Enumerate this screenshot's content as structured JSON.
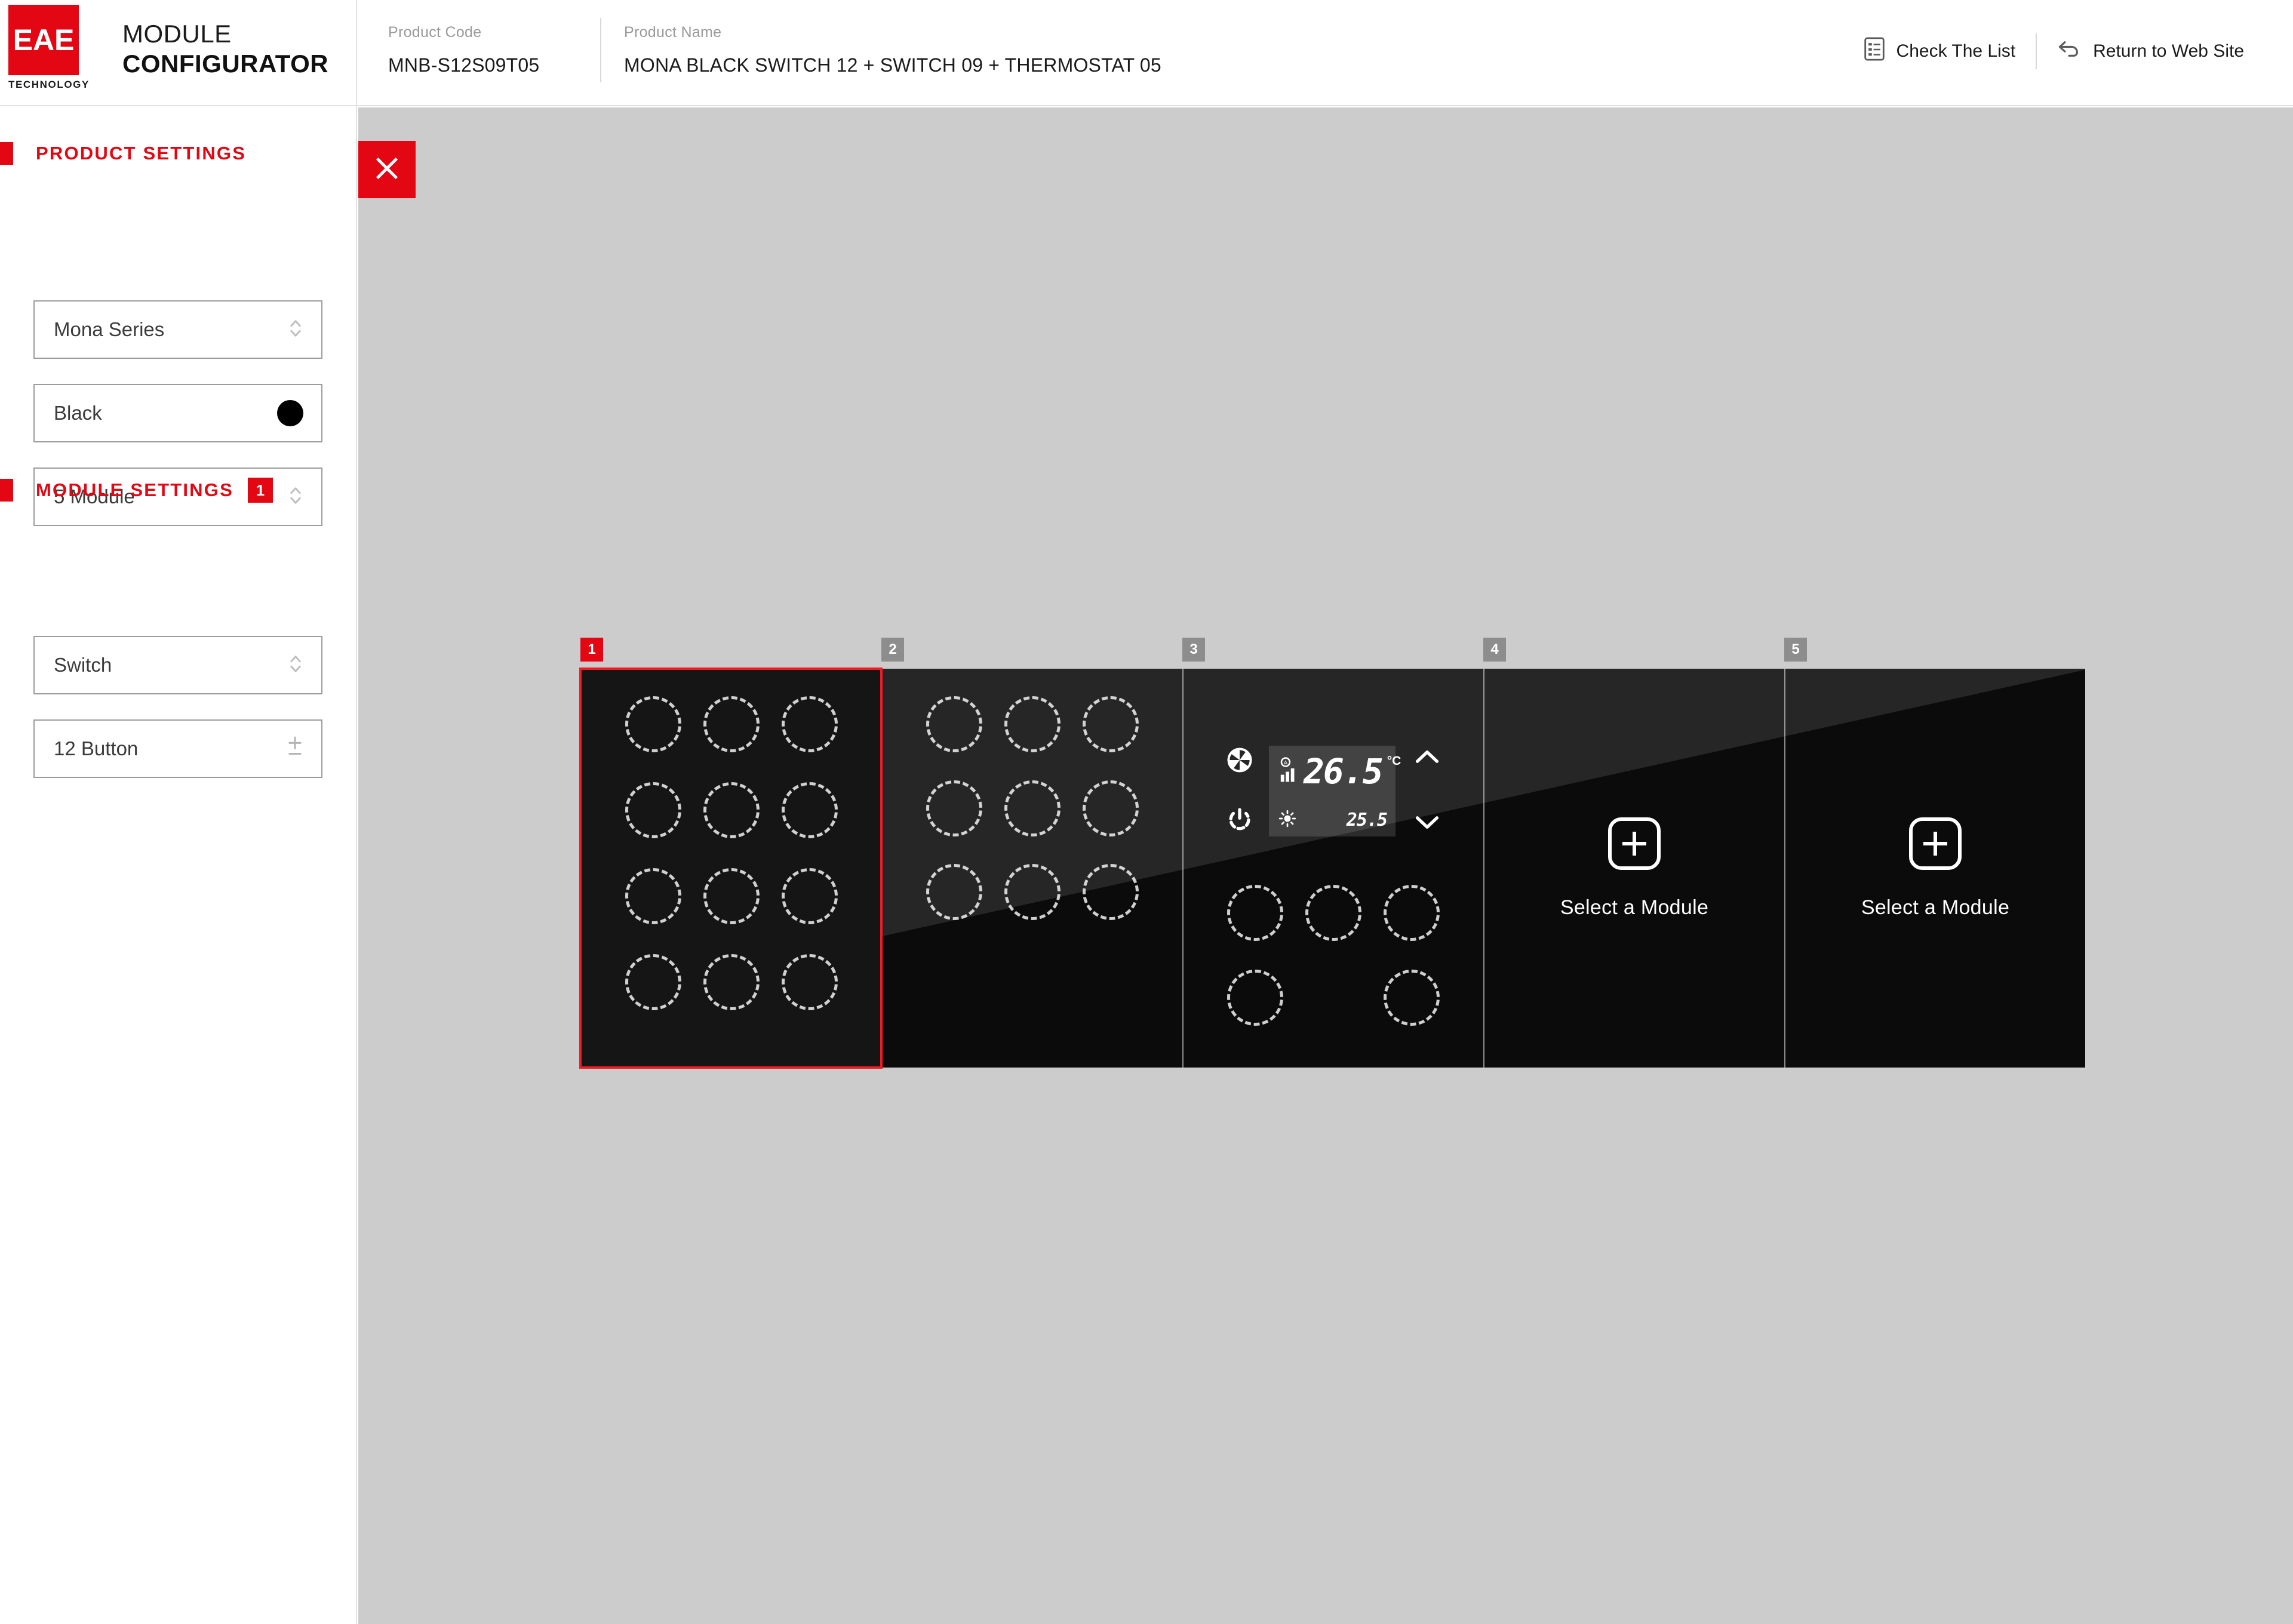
{
  "header": {
    "logo_text": "EAE",
    "logo_sub": "TECHNOLOGY",
    "title_line1": "MODULE",
    "title_line2": "CONFIGURATOR",
    "product_code_label": "Product Code",
    "product_code_value": "MNB-S12S09T05",
    "product_name_label": "Product Name",
    "product_name_value": "MONA BLACK SWITCH 12 + SWITCH 09 + THERMOSTAT 05",
    "check_list_label": "Check The List",
    "return_label": "Return to Web Site",
    "check_list_icon": "list-document-icon",
    "return_icon": "undo-arrow-icon"
  },
  "sidebar": {
    "product_settings": {
      "title": "PRODUCT SETTINGS",
      "fields": [
        {
          "value": "Mona Series",
          "control": "chevron-updown-icon"
        },
        {
          "value": "Black",
          "control": "color-swatch",
          "swatch_color": "#000000"
        },
        {
          "value": "5 Module",
          "control": "chevron-updown-icon"
        }
      ]
    },
    "module_settings": {
      "title": "MODULE SETTINGS",
      "badge": "1",
      "fields": [
        {
          "value": "Switch",
          "control": "chevron-updown-icon"
        },
        {
          "value": "12 Button",
          "control": "plus-minus-stepper-icon"
        }
      ]
    }
  },
  "canvas": {
    "close_icon": "close-x-icon",
    "modules": [
      {
        "badge": "1",
        "active": true,
        "kind": "switch",
        "buttons": 12,
        "rows": 4
      },
      {
        "badge": "2",
        "active": false,
        "kind": "switch",
        "buttons": 9,
        "rows": 3
      },
      {
        "badge": "3",
        "active": false,
        "kind": "thermostat",
        "buttons": 5,
        "rows": 2
      },
      {
        "badge": "4",
        "active": false,
        "kind": "empty",
        "label": "Select a Module"
      },
      {
        "badge": "5",
        "active": false,
        "kind": "empty",
        "label": "Select a Module"
      }
    ],
    "thermostat": {
      "fan_icon": "fan-icon",
      "power_icon": "power-icon",
      "auto_icon": "auto-fan-speed-icon",
      "sun_icon": "sun-icon",
      "up_icon": "chevron-up-icon",
      "down_icon": "chevron-down-icon",
      "current_temp": "26.5",
      "unit": "°C",
      "set_temp": "25.5"
    },
    "select_module_label": "Select a Module"
  },
  "colors": {
    "brand_red": "#e30613",
    "selection_red": "#ee1c25",
    "canvas_bg": "#cccccc",
    "panel_black": "#0b0b0b",
    "badge_gray": "#8d8d8d"
  }
}
